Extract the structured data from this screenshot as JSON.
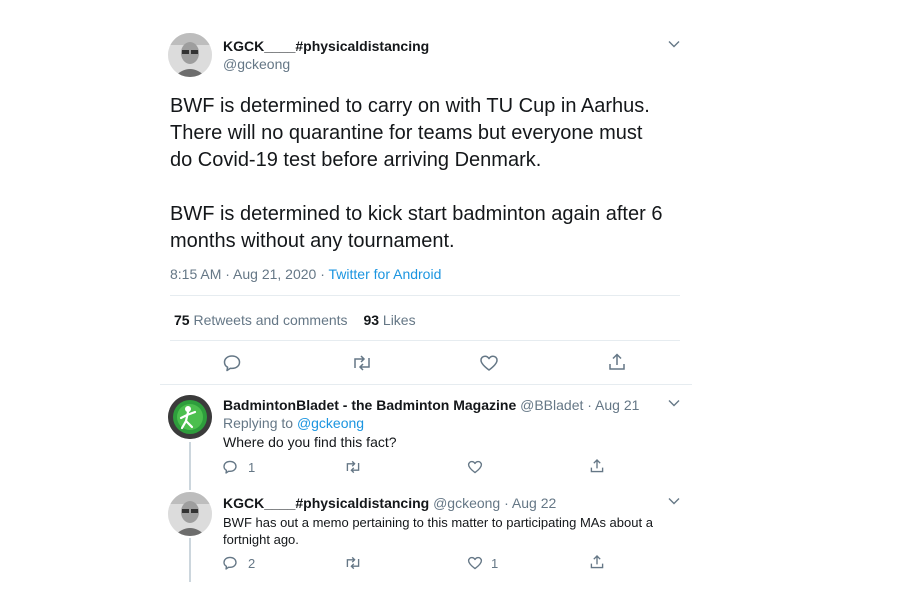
{
  "main_tweet": {
    "display_name": "KGCK____#physicaldistancing",
    "handle": "@gckeong",
    "text_line1": "BWF is determined to carry on with TU Cup in Aarhus.",
    "text_line2": "There will no quarantine for teams but everyone must",
    "text_line3": "do Covid-19 test before arriving Denmark.",
    "text_line4": "BWF is determined to kick start badminton again after 6",
    "text_line5": "months without any tournament.",
    "time": "8:15 AM · Aug 21, 2020 · ",
    "source": "Twitter for Android",
    "retweets_count": "75",
    "retweets_label": "Retweets and comments",
    "likes_count": "93",
    "likes_label": "Likes"
  },
  "replies": [
    {
      "display_name": "BadmintonBladet - the Badminton Magazine",
      "meta": "@BBladet · Aug 21",
      "replying_prefix": "Replying to ",
      "replying_handle": "@gckeong",
      "text_line1": "Where do you find this fact?",
      "reply_count": "1",
      "like_count": ""
    },
    {
      "display_name": "KGCK____#physicaldistancing",
      "meta": "@gckeong · Aug 22",
      "text_line1": "BWF has out a memo pertaining to this matter to participating MAs about a",
      "text_line2": "fortnight ago.",
      "reply_count": "2",
      "like_count": "1"
    }
  ],
  "icons": [
    "reply-icon",
    "retweet-icon",
    "like-icon",
    "share-icon",
    "chevron-down-icon",
    "avatar"
  ],
  "colors": {
    "link": "#1b95e0",
    "muted": "#657786",
    "divider": "#e6ecf0",
    "thread_line": "#ccd6dd"
  }
}
